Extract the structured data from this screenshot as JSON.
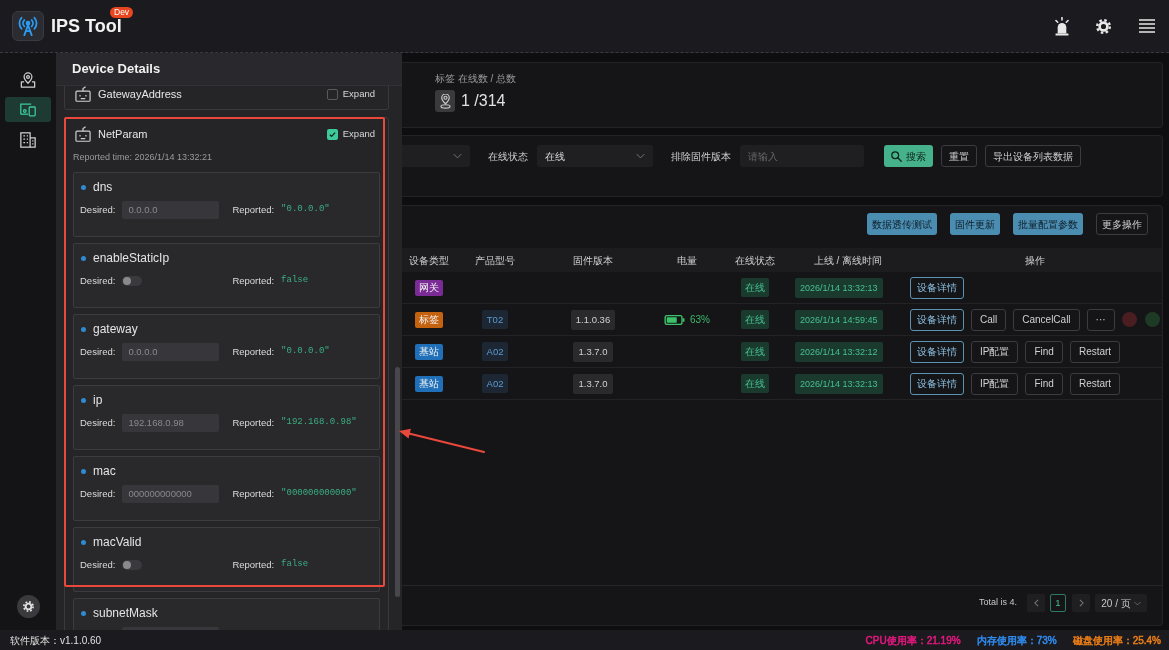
{
  "header": {
    "title": "IPS Tool",
    "badge": "Dev"
  },
  "sidebar": {
    "items": [
      {
        "kind": "map",
        "selected": false
      },
      {
        "kind": "devices",
        "selected": true
      },
      {
        "kind": "building",
        "selected": false
      }
    ]
  },
  "drawer": {
    "title": "Device Details",
    "sections": [
      {
        "name": "GatewayAddress",
        "expand_label": "Expand",
        "expanded": false
      },
      {
        "name": "NetParam",
        "expand_label": "Expand",
        "expanded": true,
        "reported_time": "Reported time: 2026/1/14 13:32:21",
        "properties": [
          {
            "name": "dns",
            "kind": "input",
            "desired_label": "Desired:",
            "desired": "0.0.0.0",
            "reported_label": "Reported:",
            "reported": "\"0.0.0.0\""
          },
          {
            "name": "enableStaticIp",
            "kind": "switch",
            "desired_label": "Desired:",
            "on": false,
            "reported_label": "Reported:",
            "reported": "false"
          },
          {
            "name": "gateway",
            "kind": "input",
            "desired_label": "Desired:",
            "desired": "0.0.0.0",
            "reported_label": "Reported:",
            "reported": "\"0.0.0.0\""
          },
          {
            "name": "ip",
            "kind": "input",
            "desired_label": "Desired:",
            "desired": "192.168.0.98",
            "reported_label": "Reported:",
            "reported": "\"192.168.0.98\""
          },
          {
            "name": "mac",
            "kind": "input",
            "desired_label": "Desired:",
            "desired": "000000000000",
            "reported_label": "Reported:",
            "reported": "\"000000000000\""
          },
          {
            "name": "macValid",
            "kind": "switch",
            "desired_label": "Desired:",
            "on": false,
            "reported_label": "Reported:",
            "reported": "false"
          },
          {
            "name": "subnetMask",
            "kind": "input"
          }
        ]
      }
    ]
  },
  "stats": {
    "label": "标签 在线数 / 总数",
    "value": "1 /314"
  },
  "filters": [
    {
      "kind": "select"
    },
    {
      "kind": "select",
      "label": "在线状态",
      "value": "在线"
    },
    {
      "kind": "input",
      "label": "排除固件版本",
      "placeholder": "请输入"
    }
  ],
  "filter_buttons": [
    {
      "label": "搜索",
      "kind": "primary"
    },
    {
      "label": "重置",
      "kind": "default"
    },
    {
      "label": "导出设备列表数据",
      "kind": "default"
    }
  ],
  "table": {
    "toolbar": [
      {
        "label": "数据透传测试",
        "kind": "primary"
      },
      {
        "label": "固件更新",
        "kind": "primary"
      },
      {
        "label": "批量配置参数",
        "kind": "primary"
      },
      {
        "label": "更多操作",
        "kind": "default"
      }
    ],
    "columns": [
      "设备类型",
      "产品型号",
      "固件版本",
      "电量",
      "在线状态",
      "上线 / 离线时间",
      "操作"
    ],
    "rows": [
      {
        "device_type": {
          "label": "网关",
          "color": "#7b2b95"
        },
        "status": "在线",
        "time": "2026/1/14 13:32:13",
        "actions": [
          {
            "label": "设备详情",
            "kind": "detail"
          }
        ]
      },
      {
        "device_type": {
          "label": "标签",
          "color": "#c4620f"
        },
        "model": "T02",
        "firmware": "1.1.0.36",
        "battery": "63%",
        "status": "在线",
        "time": "2026/1/14 14:59:45",
        "actions": [
          {
            "label": "设备详情",
            "kind": "detail"
          },
          {
            "label": "Call",
            "kind": "plain"
          },
          {
            "label": "CancelCall",
            "kind": "plain"
          },
          {
            "label": "···",
            "kind": "plain"
          }
        ],
        "lights": [
          {
            "color": "#4a1e21"
          },
          {
            "color": "#1d3b24"
          }
        ]
      },
      {
        "device_type": {
          "label": "基站",
          "color": "#1f70b8"
        },
        "model": "A02",
        "firmware": "1.3.7.0",
        "status": "在线",
        "time": "2026/1/14 13:32:12",
        "actions": [
          {
            "label": "设备详情",
            "kind": "detail"
          },
          {
            "label": "IP配置",
            "kind": "plain"
          },
          {
            "label": "Find",
            "kind": "plain"
          },
          {
            "label": "Restart",
            "kind": "plain"
          }
        ]
      },
      {
        "device_type": {
          "label": "基站",
          "color": "#1f70b8"
        },
        "model": "A02",
        "firmware": "1.3.7.0",
        "status": "在线",
        "time": "2026/1/14 13:32:13",
        "actions": [
          {
            "label": "设备详情",
            "kind": "detail"
          },
          {
            "label": "IP配置",
            "kind": "plain"
          },
          {
            "label": "Find",
            "kind": "plain"
          },
          {
            "label": "Restart",
            "kind": "plain"
          }
        ]
      }
    ]
  },
  "pagination": {
    "total": "Total is 4.",
    "pages": [
      {
        "label": "1",
        "selected": true
      }
    ],
    "page_size": "20 / 页"
  },
  "footer": {
    "version": "软件版本：v1.1.0.60",
    "metrics": [
      {
        "text": "CPU使用率：21.19%",
        "color": "#e5177f"
      },
      {
        "text": "内存使用率：73%",
        "color": "#2f8cf0"
      },
      {
        "text": "磁盘使用率：25.4%",
        "color": "#ea7d17"
      }
    ]
  }
}
